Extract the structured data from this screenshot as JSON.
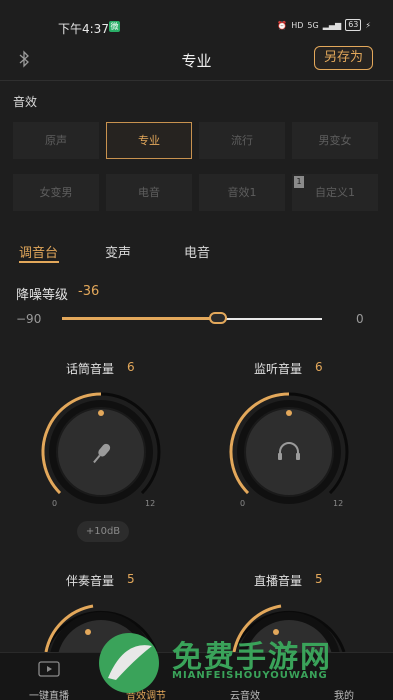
{
  "status_bar": {
    "time": "下午4:37",
    "wechat_badge": "微",
    "hd": "HD",
    "signal": "5G",
    "battery": "63",
    "lightning": "⚡"
  },
  "header": {
    "title": "专业",
    "save_as": "另存为"
  },
  "effects": {
    "label": "音效",
    "presets": [
      "原声",
      "专业",
      "流行",
      "男变女",
      "女变男",
      "电音",
      "音效1",
      "自定义1"
    ],
    "active": "专业",
    "badge": "1"
  },
  "tabs": {
    "items": [
      "调音台",
      "变声",
      "电音"
    ],
    "active": "调音台"
  },
  "noise": {
    "label": "降噪等级",
    "value": "-36",
    "min_label": "−90",
    "max_label": "0",
    "fraction": 0.6
  },
  "knobs": [
    {
      "label": "话筒音量",
      "value": "6",
      "min": "0",
      "max": "12",
      "icon": "microphone-icon"
    },
    {
      "label": "监听音量",
      "value": "6",
      "min": "0",
      "max": "12",
      "icon": "headphones-icon"
    },
    {
      "label": "伴奏音量",
      "value": "5"
    },
    {
      "label": "直播音量",
      "value": "5"
    }
  ],
  "db_button": "+10dB",
  "nav": {
    "items": [
      "一键直播",
      "音效调节",
      "云音效",
      "我的"
    ],
    "active": "音效调节"
  },
  "watermark": {
    "text": "免费手游网",
    "sub": "MIANFEISHOUYOUWANG"
  },
  "colors": {
    "accent": "#e3a85b",
    "background": "#1e1e1e"
  }
}
